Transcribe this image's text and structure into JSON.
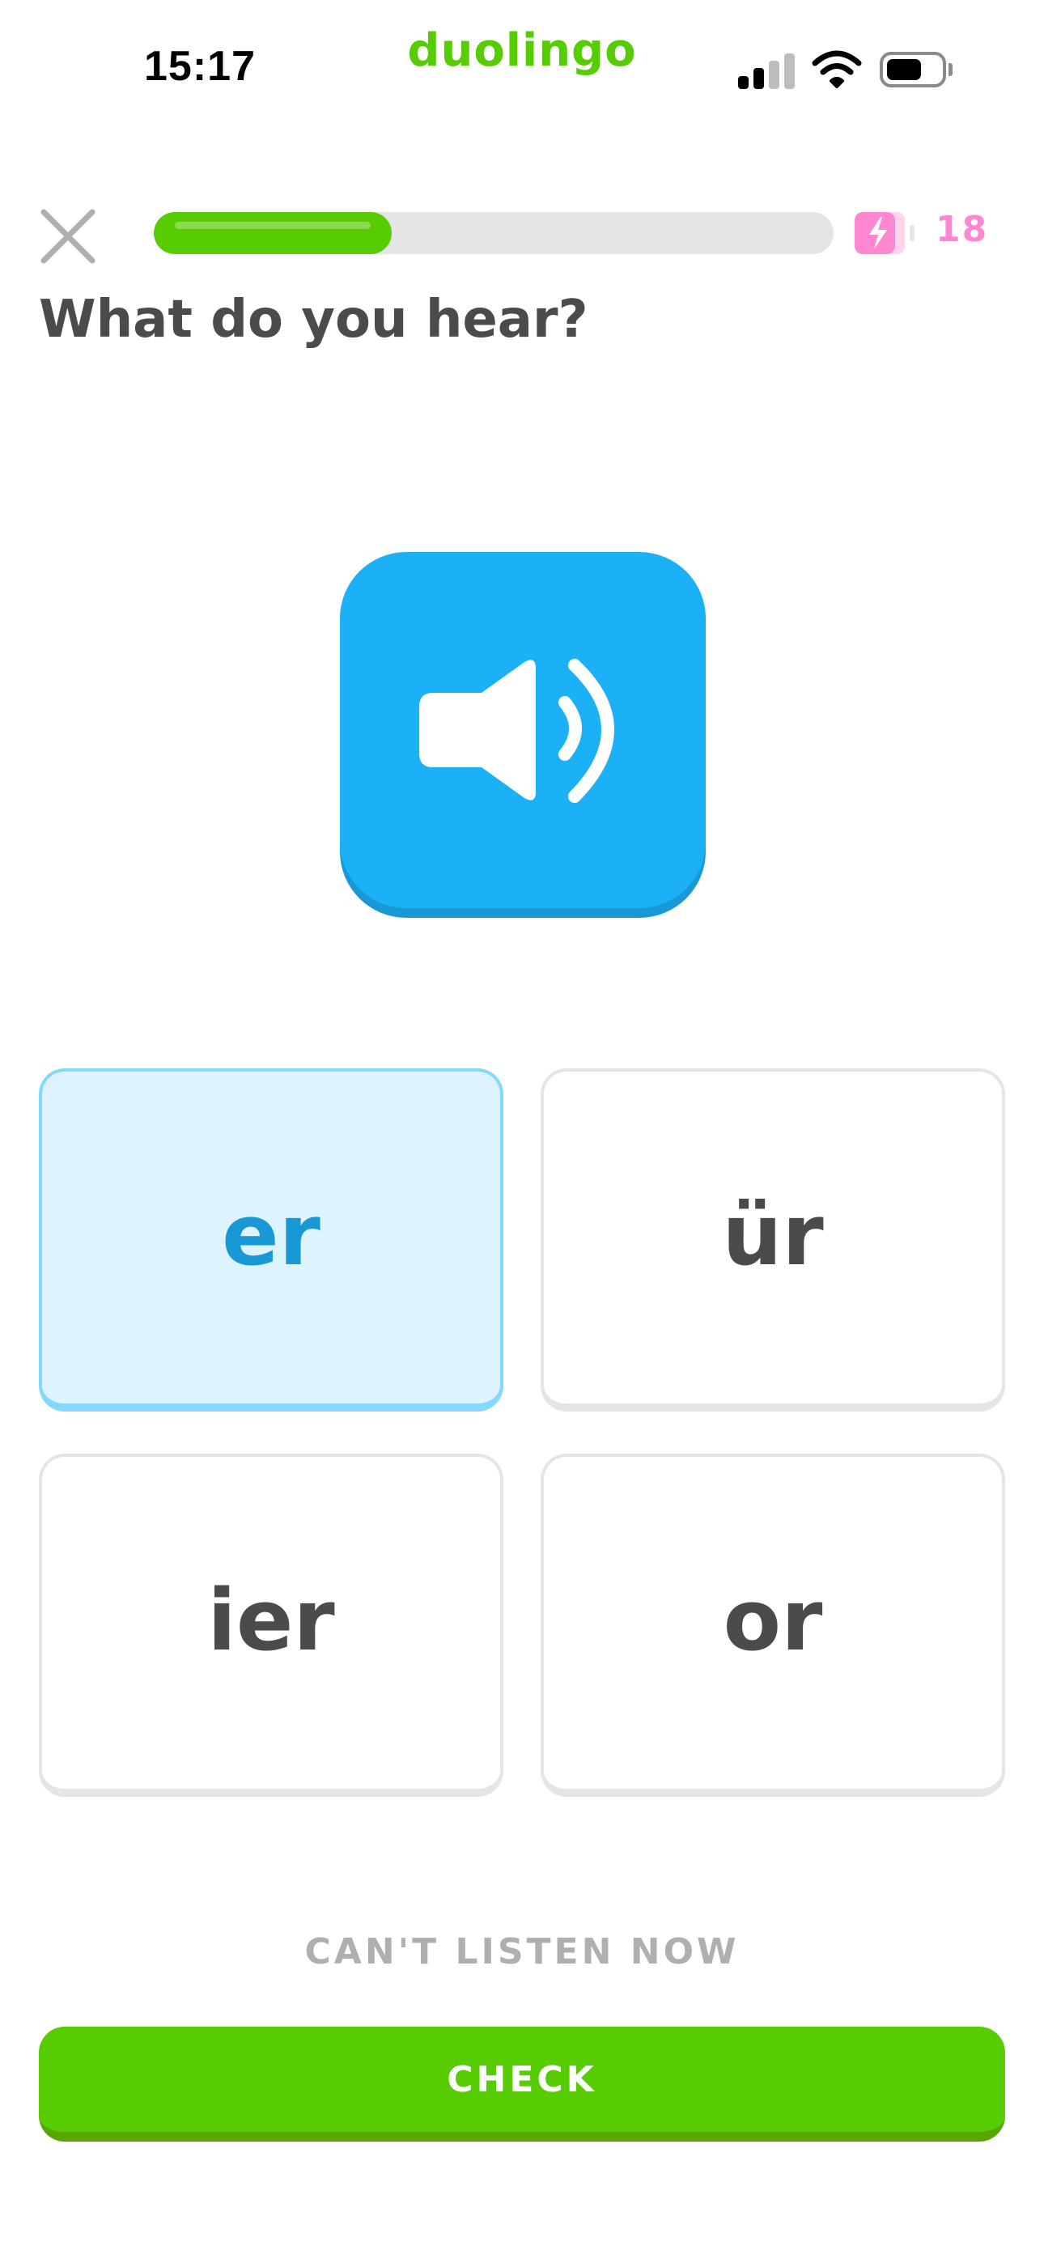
{
  "status_bar": {
    "time": "15:17",
    "app_name": "duolingo",
    "icons": [
      "signal-icon",
      "wifi-icon",
      "battery-icon"
    ]
  },
  "header": {
    "close_icon": "close-icon",
    "progress_fraction": 0.35,
    "energy_icon": "energy-battery-icon",
    "energy_count": "18"
  },
  "prompt": {
    "title": "What do you hear?"
  },
  "speaker": {
    "icon": "speaker-icon"
  },
  "choices": [
    {
      "label": "er",
      "selected": true
    },
    {
      "label": "ür",
      "selected": false
    },
    {
      "label": "ier",
      "selected": false
    },
    {
      "label": "or",
      "selected": false
    }
  ],
  "footer": {
    "cant_listen_label": "CAN'T LISTEN NOW",
    "check_label": "CHECK"
  },
  "colors": {
    "brand_green": "#58cc02",
    "speaker_blue": "#1cb0f6",
    "selected_bg": "#ddf4ff",
    "selected_border": "#84d8ff",
    "energy_pink": "#ff86d0"
  }
}
